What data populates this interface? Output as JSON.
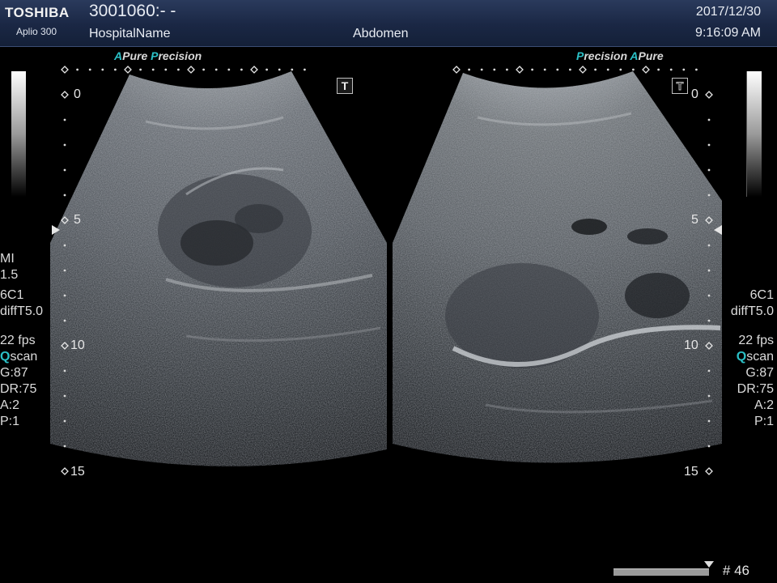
{
  "header": {
    "brand": "TOSHIBA",
    "model": "Aplio 300",
    "patient_id": "3001060:- -",
    "hospital": "HospitalName",
    "region": "Abdomen",
    "date": "2017/12/30",
    "time": "9:16:09 AM"
  },
  "left_view": {
    "mode_a": "A",
    "mode_pure": "Pure",
    "mode_p": "P",
    "mode_precision": "recision",
    "t_label": "T",
    "depth_labels": [
      "0",
      "5",
      "10",
      "15"
    ]
  },
  "right_view": {
    "mode_p": "P",
    "mode_precision": "recision",
    "mode_a": "A",
    "mode_pure": "Pure",
    "t_label": "T",
    "depth_labels": [
      "0",
      "5",
      "10",
      "15"
    ]
  },
  "left_params": {
    "mi_label": "MI",
    "mi_value": "1.5",
    "probe": "6C1",
    "filter": "diffT5.0",
    "fps": "22 fps",
    "qscan_q": "Q",
    "qscan_rest": "scan",
    "gain": "G:87",
    "dr": "DR:75",
    "a": "A:2",
    "p": "P:1"
  },
  "right_params": {
    "probe": "6C1",
    "filter": "diffT5.0",
    "fps": "22 fps",
    "qscan_q": "Q",
    "qscan_rest": "scan",
    "gain": "G:87",
    "dr": "DR:75",
    "a": "A:2",
    "p": "P:1"
  },
  "footer": {
    "frame": "# 46"
  },
  "colors": {
    "header_bg": "#1a2744",
    "accent_cyan": "#2bc0c6"
  },
  "icons": {
    "gray_scale_bar": "grayscale-gradient",
    "depth_marker": "diamond",
    "focus_marker": "triangle",
    "cine_marker": "triangle-down"
  }
}
